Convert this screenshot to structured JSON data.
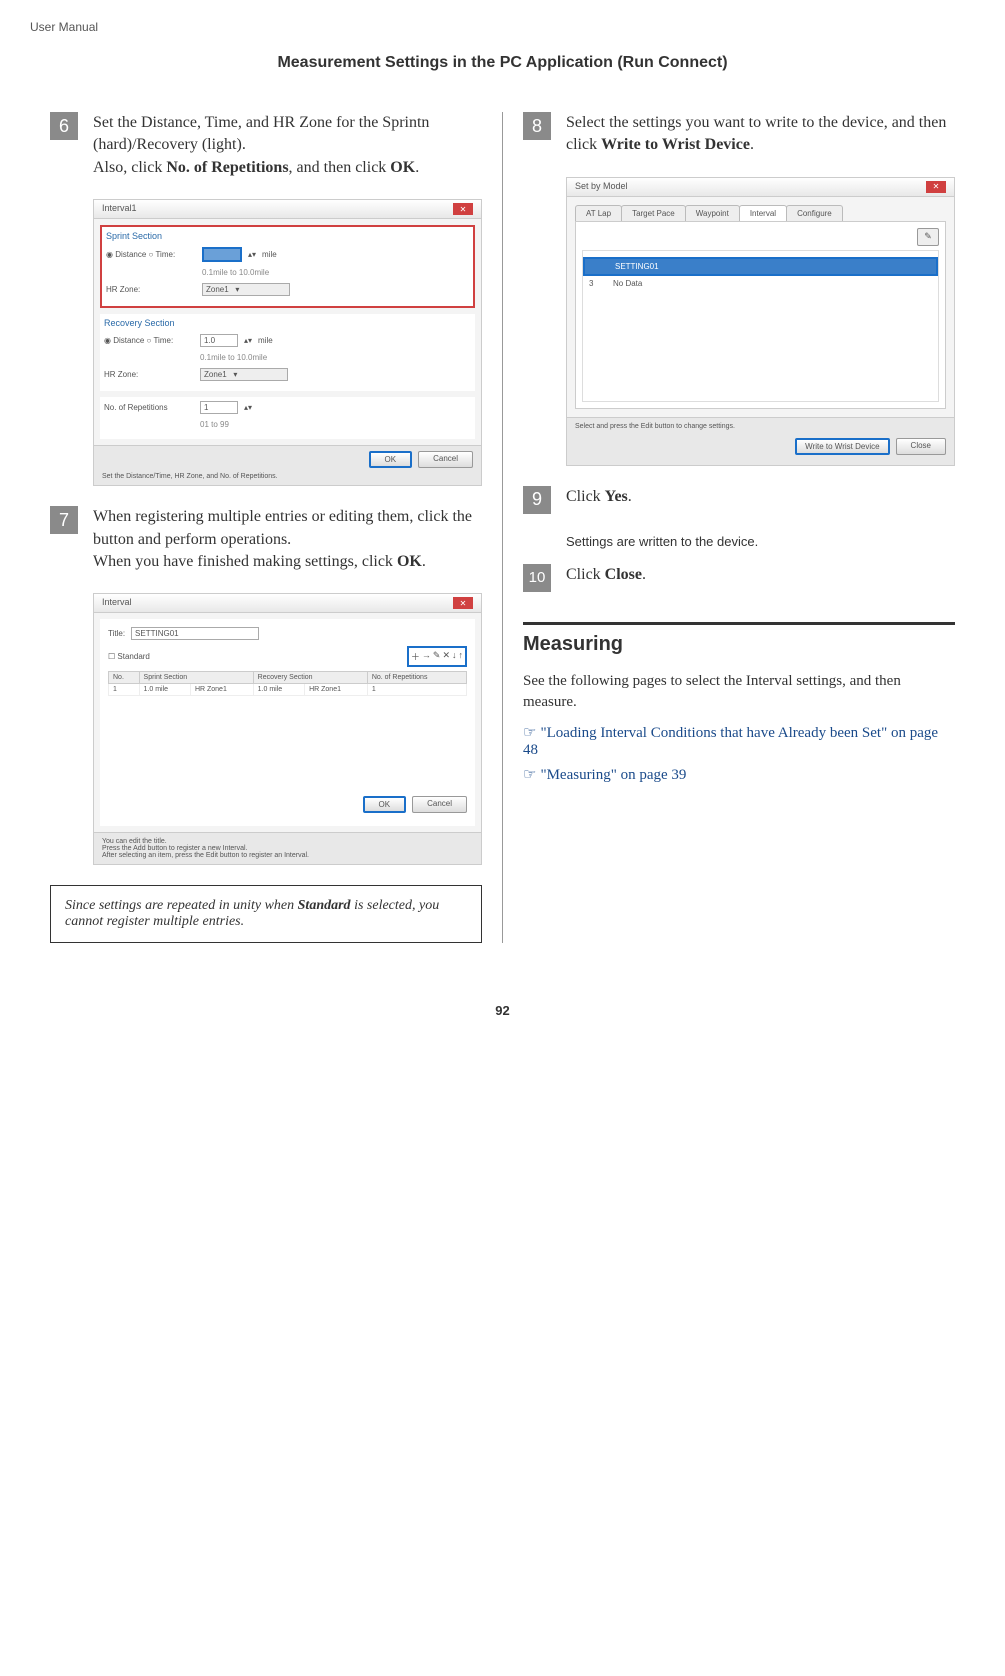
{
  "header": {
    "doc_label": "User Manual",
    "section_title": "Measurement Settings in the PC Application (Run Connect)"
  },
  "left": {
    "step6": {
      "num": "6",
      "text_a": "Set the Distance, Time, and HR Zone for the Sprintn (hard)/Recovery (light).",
      "text_b": "Also, click ",
      "bold_b": "No. of Repetitions",
      "text_c": ", and then click ",
      "bold_c": "OK",
      "text_d": "."
    },
    "shot1": {
      "title": "Interval1",
      "sprint_label": "Sprint Section",
      "dist_time": "Distance ○ Time:",
      "mile": "mile",
      "range": "0.1mile to 10.0mile",
      "hrzone": "HR Zone:",
      "zone1": "Zone1",
      "recovery_label": "Recovery Section",
      "recovery_val": "1.0",
      "reps_label": "No. of Repetitions",
      "reps_val": "1",
      "reps_range": "01 to 99",
      "ok": "OK",
      "cancel": "Cancel",
      "footer": "Set the Distance/Time, HR Zone, and No. of Repetitions."
    },
    "step7": {
      "num": "7",
      "text_a": "When registering multiple entries or editing them, click the button and perform operations.",
      "text_b": "When you have finished making settings, click ",
      "bold_b": "OK",
      "text_c": "."
    },
    "shot2": {
      "title": "Interval",
      "title_label": "Title:",
      "title_val": "SETTING01",
      "standard": "Standard",
      "col_no": "No.",
      "col_sprint": "Sprint Section",
      "col_recovery": "Recovery Section",
      "col_reps": "No. of Repetitions",
      "row1_no": "1",
      "row1_sprint": "1.0 mile",
      "row1_sprint_hr": "HR Zone1",
      "row1_rec": "1.0 mile",
      "row1_rec_hr": "HR Zone1",
      "row1_reps": "1",
      "ok": "OK",
      "cancel": "Cancel",
      "footer1": "You can edit the title.",
      "footer2": "Press the Add button to register a new Interval.",
      "footer3": "After selecting an item, press the Edit button to register an Interval."
    },
    "note": {
      "text_a": "Since settings are repeated in unity when ",
      "bold": "Standard",
      "text_b": " is selected, you cannot register multiple entries."
    }
  },
  "right": {
    "step8": {
      "num": "8",
      "text_a": "Select the settings you want to write to the device, and then click ",
      "bold_a": "Write to Wrist Device",
      "text_b": "."
    },
    "shot3": {
      "title": "Set by Model",
      "tabs": [
        "AT Lap",
        "Target Pace",
        "Waypoint",
        "Interval",
        "Configure"
      ],
      "active_tab": 3,
      "pencil": "✎",
      "sel_label": "SETTING01",
      "row3_no": "3",
      "row3_text": "No Data",
      "hint": "Select and press the Edit button to change settings.",
      "write_btn": "Write to Wrist Device",
      "close_btn": "Close"
    },
    "step9": {
      "num": "9",
      "text_a": "Click ",
      "bold_a": "Yes",
      "text_b": ".",
      "sub": "Settings are written to the device."
    },
    "step10": {
      "num": "10",
      "text_a": "Click ",
      "bold_a": "Close",
      "text_b": "."
    },
    "measuring": {
      "heading": "Measuring",
      "body": "See the following pages to select the Interval settings, and then measure.",
      "hand": "☞",
      "xref1": "\"Loading Interval Conditions that have Already been Set\" on page 48",
      "xref2": "\"Measuring\" on page 39"
    }
  },
  "page_num": "92"
}
